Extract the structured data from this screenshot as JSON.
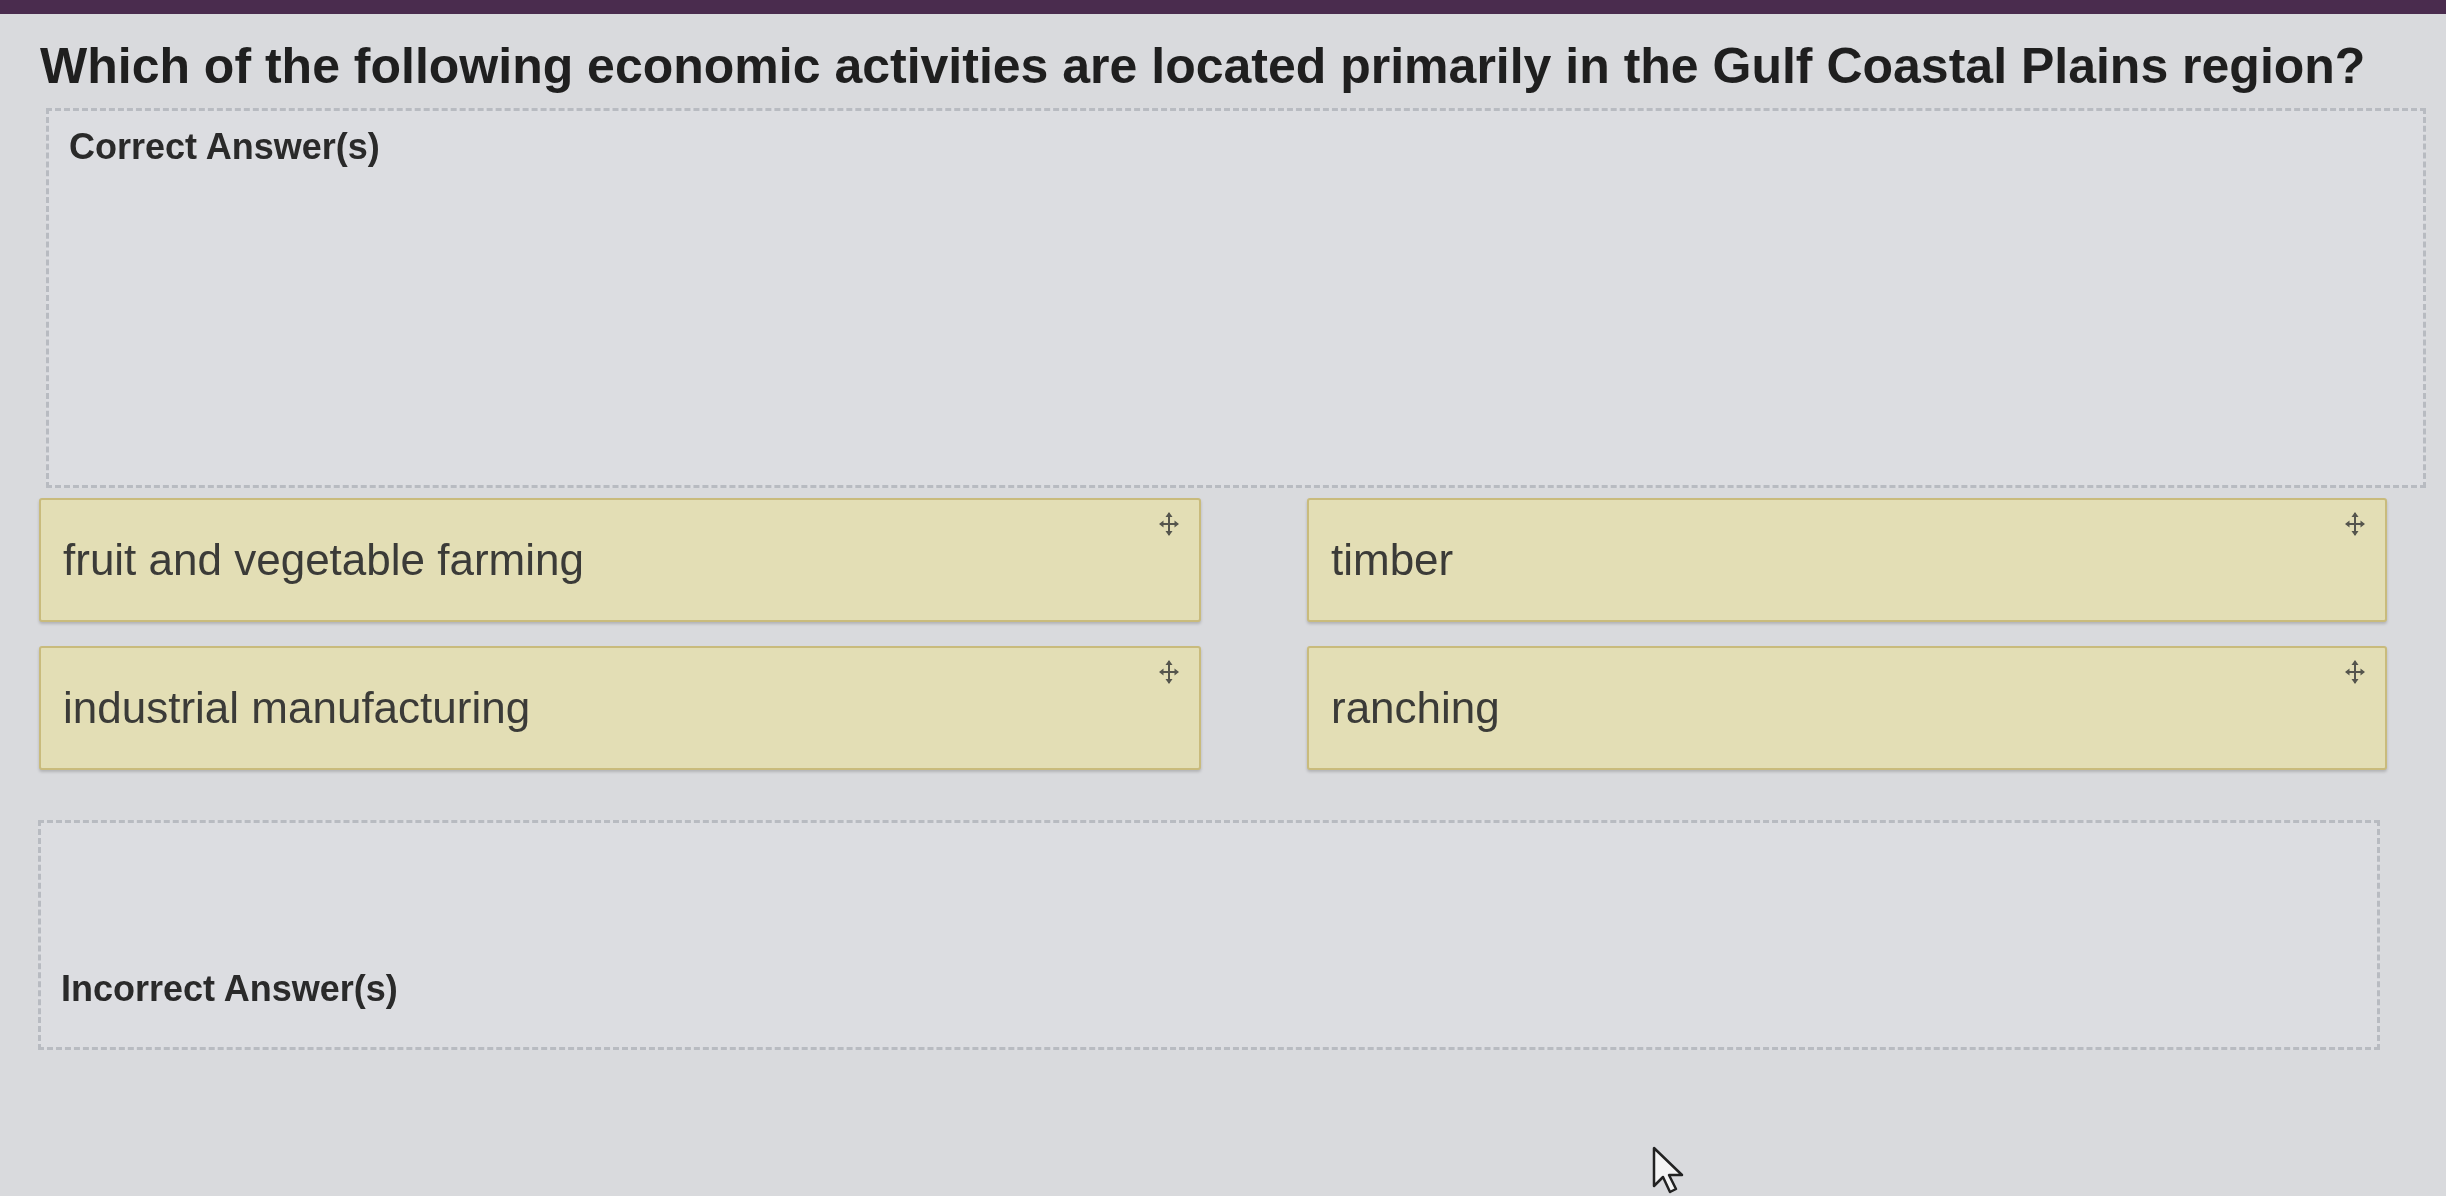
{
  "question": "Which of the following economic activities are located primarily in the Gulf Coastal Plains region?",
  "correct_zone": {
    "label": "Correct Answer(s)"
  },
  "answer_tiles": [
    {
      "text": "fruit and vegetable farming"
    },
    {
      "text": "timber"
    },
    {
      "text": "industrial manufacturing"
    },
    {
      "text": "ranching"
    }
  ],
  "incorrect_zone": {
    "label": "Incorrect Answer(s)"
  }
}
